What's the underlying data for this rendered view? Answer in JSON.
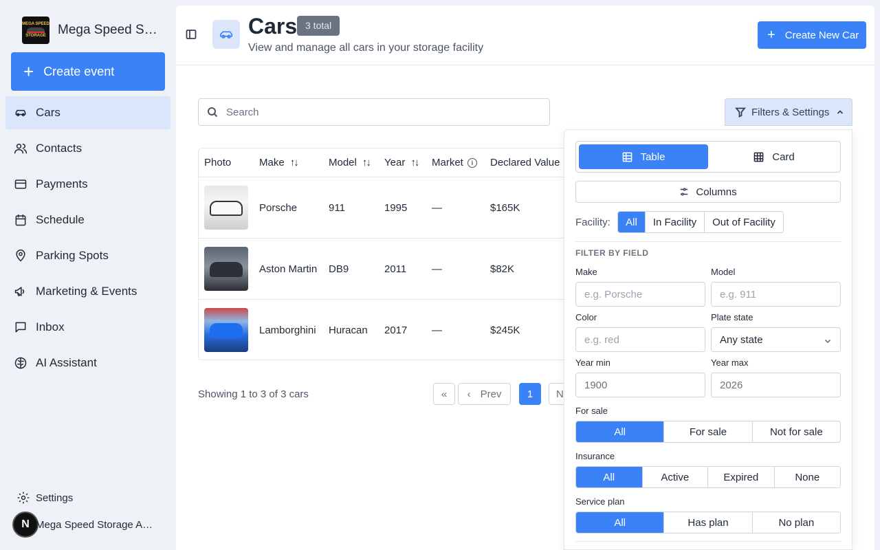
{
  "sidebar": {
    "brand_name": "Mega Speed Storage",
    "logo_text_top": "MEGA SPEED",
    "logo_text_bottom": "STORAGE",
    "create_event_label": "Create event",
    "items": [
      {
        "label": "Cars",
        "icon": "car-icon",
        "active": true
      },
      {
        "label": "Contacts",
        "icon": "users-icon"
      },
      {
        "label": "Payments",
        "icon": "credit-card-icon"
      },
      {
        "label": "Schedule",
        "icon": "calendar-icon"
      },
      {
        "label": "Parking Spots",
        "icon": "map-pin-icon"
      },
      {
        "label": "Marketing & Events",
        "icon": "megaphone-icon"
      },
      {
        "label": "Inbox",
        "icon": "message-square-icon"
      },
      {
        "label": "AI Assistant",
        "icon": "brain-icon"
      }
    ],
    "settings_label": "Settings",
    "user_initial": "N",
    "user_name": "Mega Speed Storage Admin"
  },
  "header": {
    "title": "Cars",
    "total_badge": "3 total",
    "subtitle": "View and manage all cars in your storage facility",
    "create_button": "Create New Car"
  },
  "search": {
    "placeholder": "Search"
  },
  "filters_button": "Filters & Settings",
  "table": {
    "columns": [
      "Photo",
      "Make",
      "Model",
      "Year",
      "Market",
      "Declared Value"
    ],
    "sort_glyph": "↑↓",
    "info_glyph": "i",
    "rows": [
      {
        "make": "Porsche",
        "model": "911",
        "year": "1995",
        "market": "—",
        "declared": "$165K"
      },
      {
        "make": "Aston Martin",
        "model": "DB9",
        "year": "2011",
        "market": "—",
        "declared": "$82K"
      },
      {
        "make": "Lamborghini",
        "model": "Huracan",
        "year": "2017",
        "market": "—",
        "declared": "$245K"
      }
    ]
  },
  "pagination": {
    "summary": "Showing 1 to 3 of 3 cars",
    "first": "«",
    "prev": "Prev",
    "prev_chevron": "‹",
    "current": "1",
    "next": "N"
  },
  "panel": {
    "view_table": "Table",
    "view_card": "Card",
    "columns_button": "Columns",
    "facility_label": "Facility:",
    "facility_options": [
      "All",
      "In Facility",
      "Out of Facility"
    ],
    "section_title": "FILTER BY FIELD",
    "make_label": "Make",
    "make_placeholder": "e.g. Porsche",
    "model_label": "Model",
    "model_placeholder": "e.g. 911",
    "color_label": "Color",
    "color_placeholder": "e.g. red",
    "plate_state_label": "Plate state",
    "plate_state_value": "Any state",
    "year_min_label": "Year min",
    "year_min_value": "1900",
    "year_max_label": "Year max",
    "year_max_value": "2026",
    "for_sale_label": "For sale",
    "for_sale_options": [
      "All",
      "For sale",
      "Not for sale"
    ],
    "insurance_label": "Insurance",
    "insurance_options": [
      "All",
      "Active",
      "Expired",
      "None"
    ],
    "service_plan_label": "Service plan",
    "service_plan_options": [
      "All",
      "Has plan",
      "No plan"
    ]
  },
  "colors": {
    "accent": "#3b82f6",
    "active_nav_bg": "#dbe6fb"
  }
}
